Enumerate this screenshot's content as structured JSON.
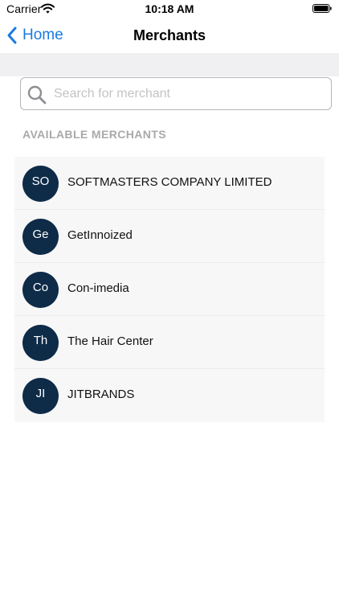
{
  "status_bar": {
    "carrier": "Carrier",
    "time": "10:18 AM"
  },
  "nav": {
    "back_label": "Home",
    "title": "Merchants"
  },
  "search": {
    "placeholder": "Search for merchant",
    "value": ""
  },
  "section": {
    "header": "AVAILABLE MERCHANTS"
  },
  "merchants": [
    {
      "initials": "SO",
      "name": "SOFTMASTERS COMPANY LIMITED"
    },
    {
      "initials": "Ge",
      "name": "GetInnoized"
    },
    {
      "initials": "Co",
      "name": "Con-imedia"
    },
    {
      "initials": "Th",
      "name": "The Hair Center"
    },
    {
      "initials": "JI",
      "name": "JITBRANDS"
    }
  ],
  "colors": {
    "accent": "#1a7be0",
    "avatar_bg": "#0e2b48",
    "list_bg": "#f7f7f7"
  },
  "icons": {
    "wifi": "wifi-icon",
    "battery": "battery-icon",
    "back": "chevron-left-icon",
    "search": "search-icon"
  }
}
